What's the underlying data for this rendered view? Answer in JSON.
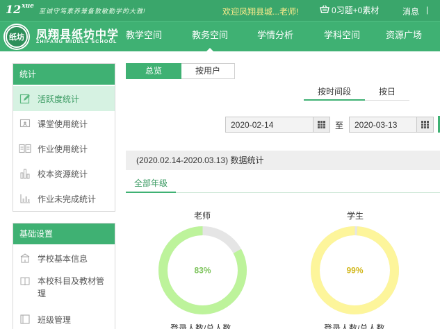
{
  "topbar": {
    "brand": "12",
    "brand_sup": "xue",
    "slogan": "至诚守笃素养兼备敦敏勤学的大雅!",
    "welcome": "欢迎凤翔县城...老师!",
    "basket": "0习题+0素材",
    "messages": "消息",
    "separator": "|"
  },
  "header": {
    "logo_text": "纸坊",
    "school_name": "凤翔县纸坊中学",
    "school_en": "ZHIFANG MIDDLE SCHOOL",
    "nav": [
      {
        "label": "教学空间"
      },
      {
        "label": "教务空间"
      },
      {
        "label": "学情分析"
      },
      {
        "label": "学科空间"
      },
      {
        "label": "资源广场"
      }
    ]
  },
  "sidebar": {
    "stats_title": "统计",
    "stats_items": [
      {
        "label": "活跃度统计",
        "icon": "edit-icon"
      },
      {
        "label": "课堂使用统计",
        "icon": "classroom-icon"
      },
      {
        "label": "作业使用统计",
        "icon": "homework-icon"
      },
      {
        "label": "校本资源统计",
        "icon": "bar-chart-icon"
      },
      {
        "label": "作业未完成统计",
        "icon": "chart-icon"
      }
    ],
    "settings_title": "基础设置",
    "settings_items": [
      {
        "label": "学校基本信息",
        "icon": "school-icon"
      },
      {
        "label": "本校科目及教材管理",
        "icon": "book-icon"
      },
      {
        "label": "班级管理",
        "icon": "class-icon"
      }
    ]
  },
  "main": {
    "tabs": [
      {
        "label": "总览"
      },
      {
        "label": "按用户"
      }
    ],
    "subtabs": [
      {
        "label": "按时间段"
      },
      {
        "label": "按日"
      }
    ],
    "date_from": "2020-02-14",
    "date_sep": "至",
    "date_to": "2020-03-13",
    "stat_title": "(2020.02.14-2020.03.13) 数据统计",
    "grade_tab": "全部年级",
    "donuts": [
      {
        "title": "老师",
        "percent_label": "83%",
        "value": 83,
        "color": "#bdf39b",
        "track": "#e5e5e5",
        "text_color": "#7cc35a",
        "caption": "登录人数/总人数"
      },
      {
        "title": "学生",
        "percent_label": "99%",
        "value": 99,
        "color": "#fdf59b",
        "track": "#e5e5e5",
        "text_color": "#d2b81e",
        "caption": "登录人数/总人数"
      }
    ]
  },
  "colors": {
    "primary": "#3fb173",
    "topbar": "#3aa66b",
    "active_bg": "#d6f2e2"
  }
}
